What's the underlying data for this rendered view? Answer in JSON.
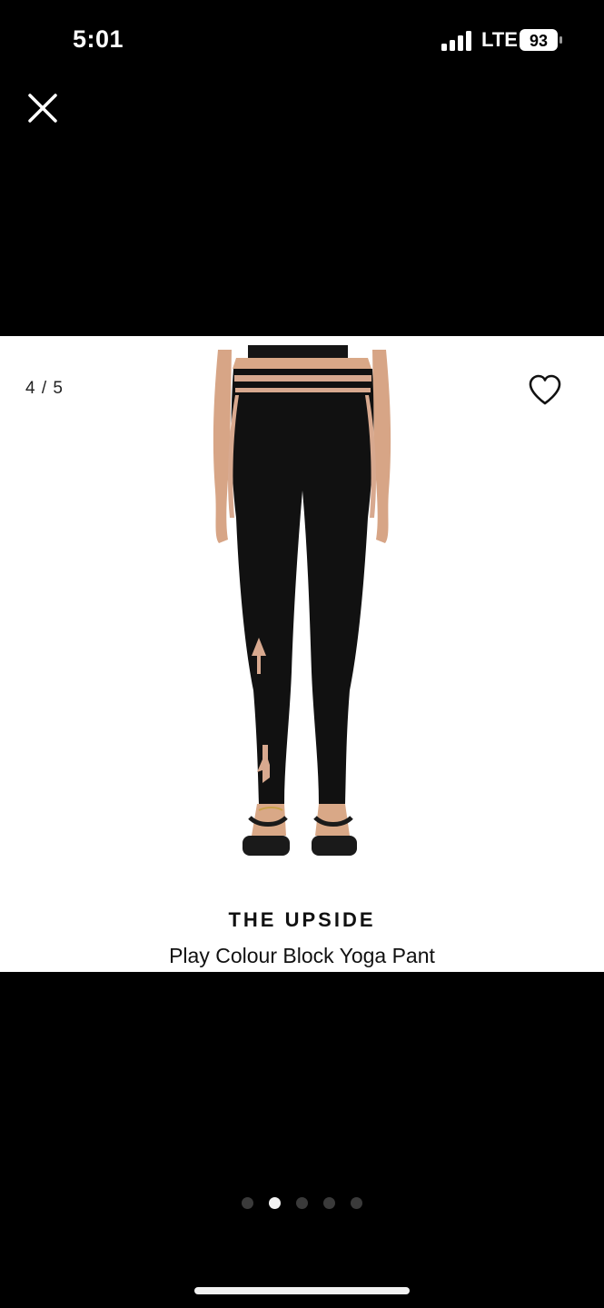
{
  "status_bar": {
    "time": "5:01",
    "network": "LTE",
    "battery": "93"
  },
  "viewer": {
    "counter": "4 / 5",
    "total_images": 5,
    "active_dot_index": 1
  },
  "product": {
    "brand": "THE UPSIDE",
    "name": "Play Colour Block Yoga Pant",
    "image_alt": "Back view of black leggings with nude colour block stripes and arrow print"
  },
  "colors": {
    "background": "#000000",
    "card": "#ffffff",
    "legging": "#111111",
    "accent_nude": "#d8a98f",
    "skin": "#d9a887"
  }
}
